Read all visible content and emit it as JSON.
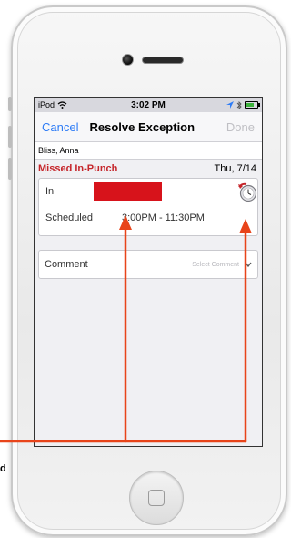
{
  "status_bar": {
    "carrier": "iPod",
    "time": "3:02 PM"
  },
  "nav": {
    "cancel_label": "Cancel",
    "title": "Resolve Exception",
    "done_label": "Done"
  },
  "employee": {
    "name": "Bliss, Anna"
  },
  "exception": {
    "type": "Missed In-Punch",
    "date": "Thu, 7/14"
  },
  "punch": {
    "in_label": "In",
    "scheduled_label": "Scheduled",
    "scheduled_value": "3:00PM - 11:30PM"
  },
  "comment": {
    "label": "Comment",
    "placeholder": "Select Comment"
  },
  "annotation": {
    "edge_letter": "d",
    "arrow_color": "#e8441a",
    "redaction_color": "#d7131b"
  },
  "icons": [
    "wifi-icon",
    "location-icon",
    "bluetooth-icon",
    "battery-icon",
    "clock-reset-icon",
    "chevron-down-icon"
  ]
}
